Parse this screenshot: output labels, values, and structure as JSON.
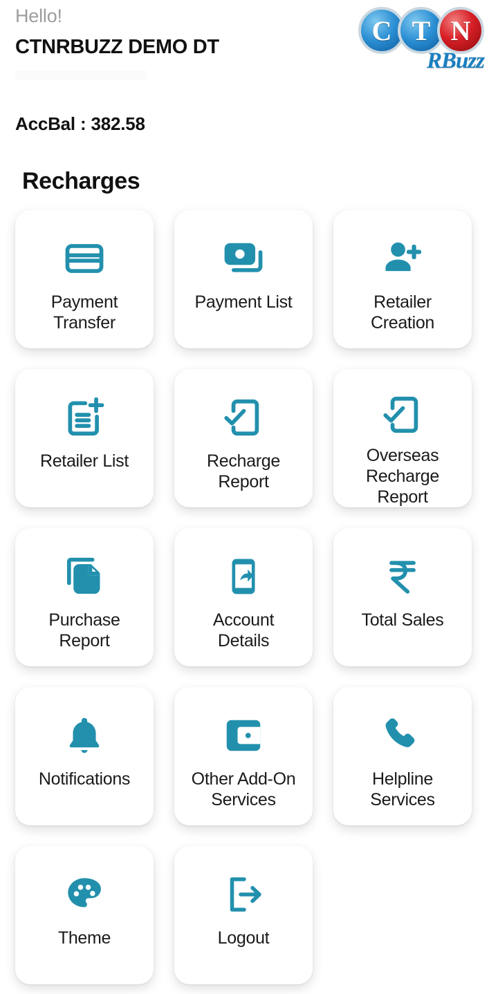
{
  "header": {
    "greeting": "Hello!",
    "account_name": "CTNRBUZZ DEMO DT",
    "balance_label": "AccBal : 382.58"
  },
  "logo": {
    "letter1": "C",
    "letter2": "T",
    "letter3": "N",
    "wordmark": "RBuzz",
    "circle_blue": "#2b8fd4",
    "circle_red": "#d81f26",
    "wordmark_color": "#1a7fc1"
  },
  "theme": {
    "accent": "#2290ad",
    "card_background": "#ffffff",
    "page_background": "#ffffff",
    "text_primary": "#111111",
    "text_muted": "#9d9d9d"
  },
  "main": {
    "section_title": "Recharges",
    "tiles": [
      {
        "label": "Payment\nTransfer",
        "icon": "credit-card-icon"
      },
      {
        "label": "Payment List",
        "icon": "cash-stack-icon"
      },
      {
        "label": "Retailer\nCreation",
        "icon": "person-add-icon"
      },
      {
        "label": "Retailer List",
        "icon": "note-add-icon"
      },
      {
        "label": "Recharge\nReport",
        "icon": "phone-check-icon"
      },
      {
        "label": "Overseas\nRecharge\nReport",
        "icon": "phone-check-icon"
      },
      {
        "label": "Purchase\nReport",
        "icon": "copy-documents-icon"
      },
      {
        "label": "Account\nDetails",
        "icon": "phone-share-icon"
      },
      {
        "label": "Total Sales",
        "icon": "rupee-icon"
      },
      {
        "label": "Notifications",
        "icon": "bell-icon"
      },
      {
        "label": "Other Add-On\nServices",
        "icon": "wallet-icon"
      },
      {
        "label": "Helpline\nServices",
        "icon": "phone-call-icon"
      },
      {
        "label": "Theme",
        "icon": "palette-icon"
      },
      {
        "label": "Logout",
        "icon": "logout-icon"
      }
    ]
  }
}
